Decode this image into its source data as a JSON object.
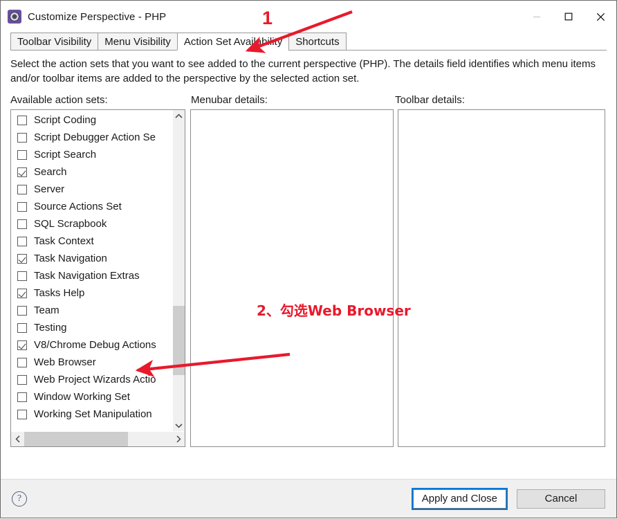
{
  "window": {
    "title": "Customize Perspective - PHP",
    "icon": "eclipse-perspective-icon",
    "controls": {
      "minimize": "minimize-icon",
      "maximize": "maximize-icon",
      "close": "close-icon"
    }
  },
  "tabs": [
    {
      "label": "Toolbar Visibility",
      "active": false
    },
    {
      "label": "Menu Visibility",
      "active": false
    },
    {
      "label": "Action Set Availability",
      "active": true
    },
    {
      "label": "Shortcuts",
      "active": false
    }
  ],
  "description": "Select the action sets that you want to see added to the current perspective (PHP).  The details field identifies which menu items and/or toolbar items are added to the perspective by the selected action set.",
  "columns": {
    "available": "Available action sets:",
    "menubar": "Menubar details:",
    "toolbar": "Toolbar details:"
  },
  "action_sets": [
    {
      "label": "Script Coding",
      "checked": false
    },
    {
      "label": "Script Debugger Action Se",
      "checked": false
    },
    {
      "label": "Script Search",
      "checked": false
    },
    {
      "label": "Search",
      "checked": true
    },
    {
      "label": "Server",
      "checked": false
    },
    {
      "label": "Source Actions Set",
      "checked": false
    },
    {
      "label": "SQL Scrapbook",
      "checked": false
    },
    {
      "label": "Task Context",
      "checked": false
    },
    {
      "label": "Task Navigation",
      "checked": true
    },
    {
      "label": "Task Navigation Extras",
      "checked": false
    },
    {
      "label": "Tasks Help",
      "checked": true
    },
    {
      "label": "Team",
      "checked": false
    },
    {
      "label": "Testing",
      "checked": false
    },
    {
      "label": "V8/Chrome Debug Actions",
      "checked": true
    },
    {
      "label": "Web Browser",
      "checked": false
    },
    {
      "label": "Web Project Wizards Actio",
      "checked": false
    },
    {
      "label": "Window Working Set",
      "checked": false
    },
    {
      "label": "Working Set Manipulation",
      "checked": false
    }
  ],
  "scrollbars": {
    "vertical_up": "chevron-up-icon",
    "vertical_down": "chevron-down-icon",
    "horizontal_left": "chevron-left-icon",
    "horizontal_right": "chevron-right-icon"
  },
  "details": {
    "menubar_content": "",
    "toolbar_content": ""
  },
  "footer": {
    "help": "?",
    "apply_button": "Apply and Close",
    "cancel_button": "Cancel"
  },
  "annotations": {
    "step1": "1",
    "step2": "2、勾选Web Browser",
    "color": "#e8192c"
  }
}
